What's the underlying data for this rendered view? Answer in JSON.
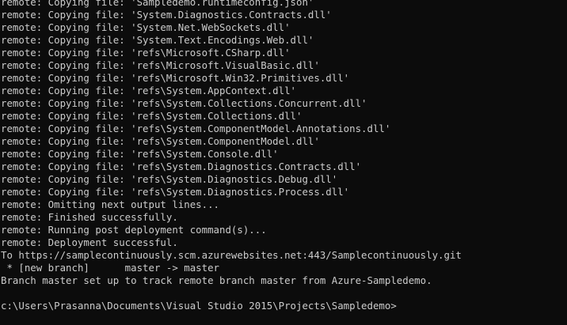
{
  "terminal": {
    "lines": [
      "remote: Copying file: 'Sampledemo.runtimeconfig.json'",
      "remote: Copying file: 'System.Diagnostics.Contracts.dll'",
      "remote: Copying file: 'System.Net.WebSockets.dll'",
      "remote: Copying file: 'System.Text.Encodings.Web.dll'",
      "remote: Copying file: 'refs\\Microsoft.CSharp.dll'",
      "remote: Copying file: 'refs\\Microsoft.VisualBasic.dll'",
      "remote: Copying file: 'refs\\Microsoft.Win32.Primitives.dll'",
      "remote: Copying file: 'refs\\System.AppContext.dll'",
      "remote: Copying file: 'refs\\System.Collections.Concurrent.dll'",
      "remote: Copying file: 'refs\\System.Collections.dll'",
      "remote: Copying file: 'refs\\System.ComponentModel.Annotations.dll'",
      "remote: Copying file: 'refs\\System.ComponentModel.dll'",
      "remote: Copying file: 'refs\\System.Console.dll'",
      "remote: Copying file: 'refs\\System.Diagnostics.Contracts.dll'",
      "remote: Copying file: 'refs\\System.Diagnostics.Debug.dll'",
      "remote: Copying file: 'refs\\System.Diagnostics.Process.dll'",
      "remote: Omitting next output lines...",
      "remote: Finished successfully.",
      "remote: Running post deployment command(s)...",
      "remote: Deployment successful.",
      "To https://samplecontinuously.scm.azurewebsites.net:443/Samplecontinuously.git",
      " * [new branch]      master -> master",
      "Branch master set up to track remote branch master from Azure-Sampledemo.",
      "",
      "c:\\Users\\Prasanna\\Documents\\Visual Studio 2015\\Projects\\Sampledemo>"
    ]
  }
}
